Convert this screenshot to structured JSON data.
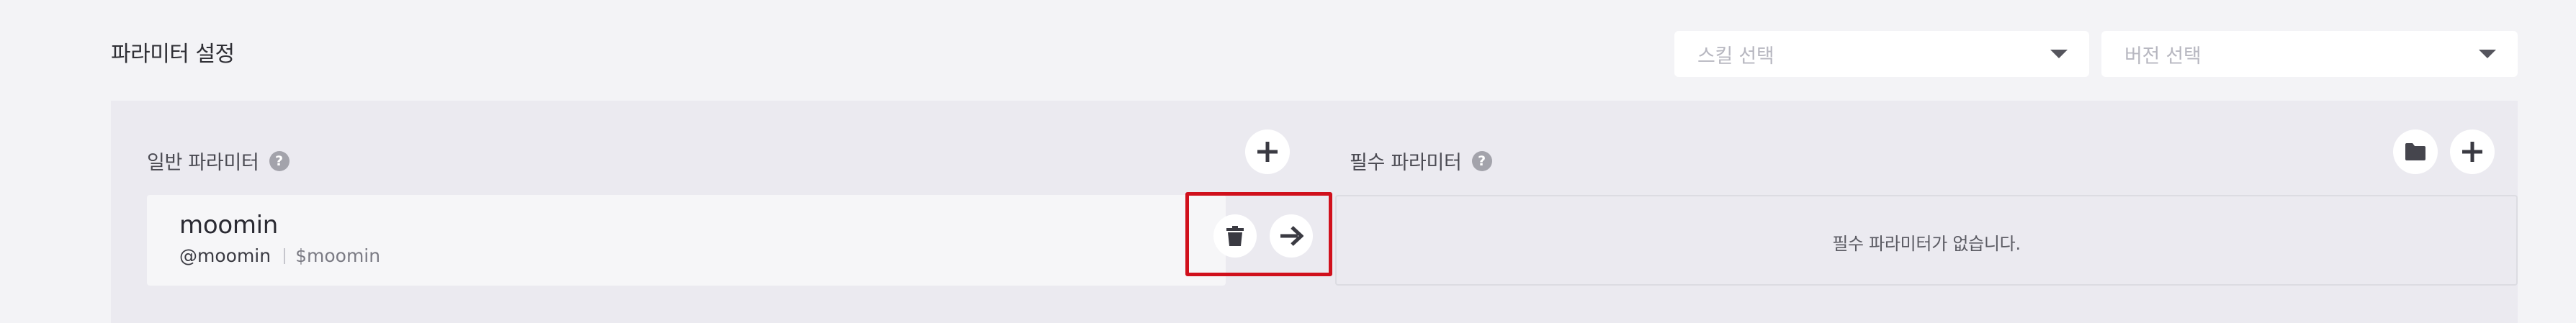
{
  "header": {
    "title": "파라미터 설정",
    "skill_select": {
      "placeholder": "스킬 선택"
    },
    "version_select": {
      "placeholder": "버전 선택"
    }
  },
  "general_params": {
    "label": "일반 파라미터",
    "help_glyph": "?",
    "items": [
      {
        "name": "moomin",
        "entity": "@moomin",
        "variable": "$moomin"
      }
    ]
  },
  "required_params": {
    "label": "필수 파라미터",
    "help_glyph": "?",
    "empty_message": "필수 파라미터가 없습니다."
  },
  "icons": {
    "add": "plus-icon",
    "folder": "folder-icon",
    "delete": "trash-icon",
    "move": "arrow-right-icon",
    "help": "question-mark-icon",
    "dropdown": "caret-down-icon"
  },
  "colors": {
    "highlight": "#d0101c",
    "panel_bg": "#ebeaf0",
    "page_bg": "#f3f3f6"
  }
}
